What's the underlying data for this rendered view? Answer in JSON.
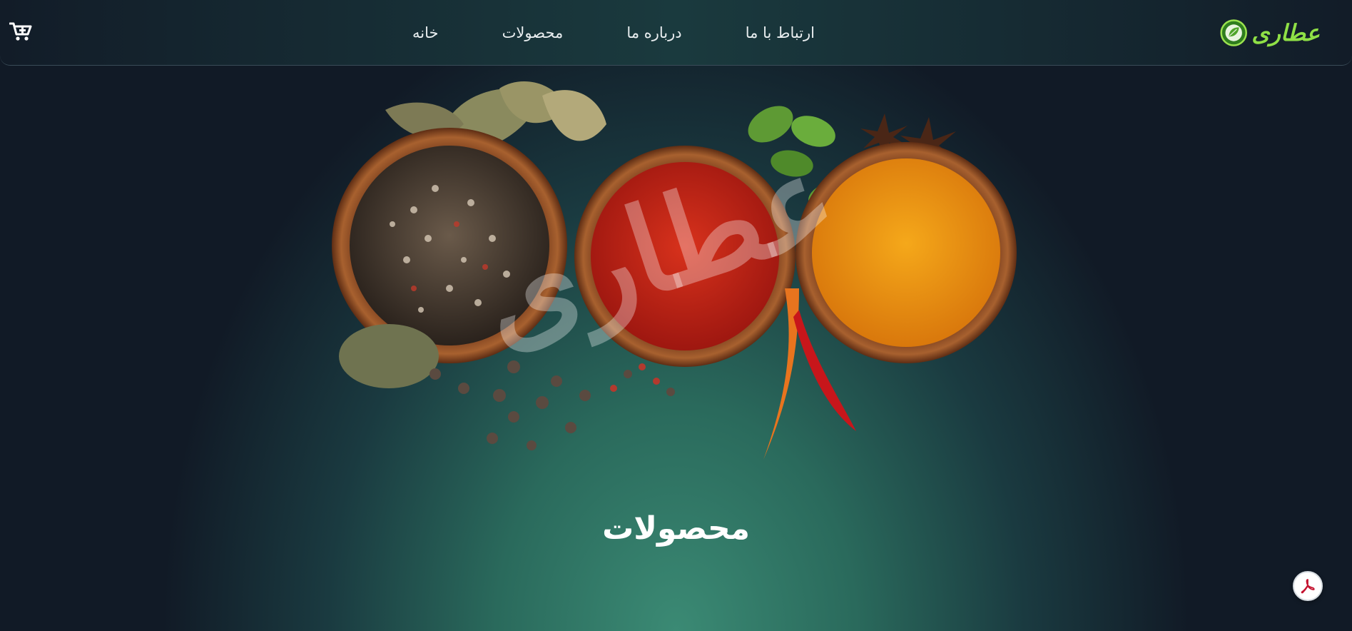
{
  "brand": {
    "name": "عطاری",
    "color": "#8fe046",
    "logo_icon": "leaf-circle-icon"
  },
  "nav": {
    "items": [
      {
        "label": "خانه"
      },
      {
        "label": "محصولات"
      },
      {
        "label": "درباره ما"
      },
      {
        "label": "ارتباط با ما"
      }
    ]
  },
  "cart": {
    "icon": "cart-plus-icon"
  },
  "hero": {
    "watermark": "عطاری"
  },
  "section": {
    "title": "محصولات"
  },
  "pdf_button": {
    "icon": "pdf-icon",
    "color": "#c4122f"
  },
  "colors": {
    "nav_bg": "#121c28",
    "accent_green": "#8fe046",
    "text": "#ffffff"
  }
}
